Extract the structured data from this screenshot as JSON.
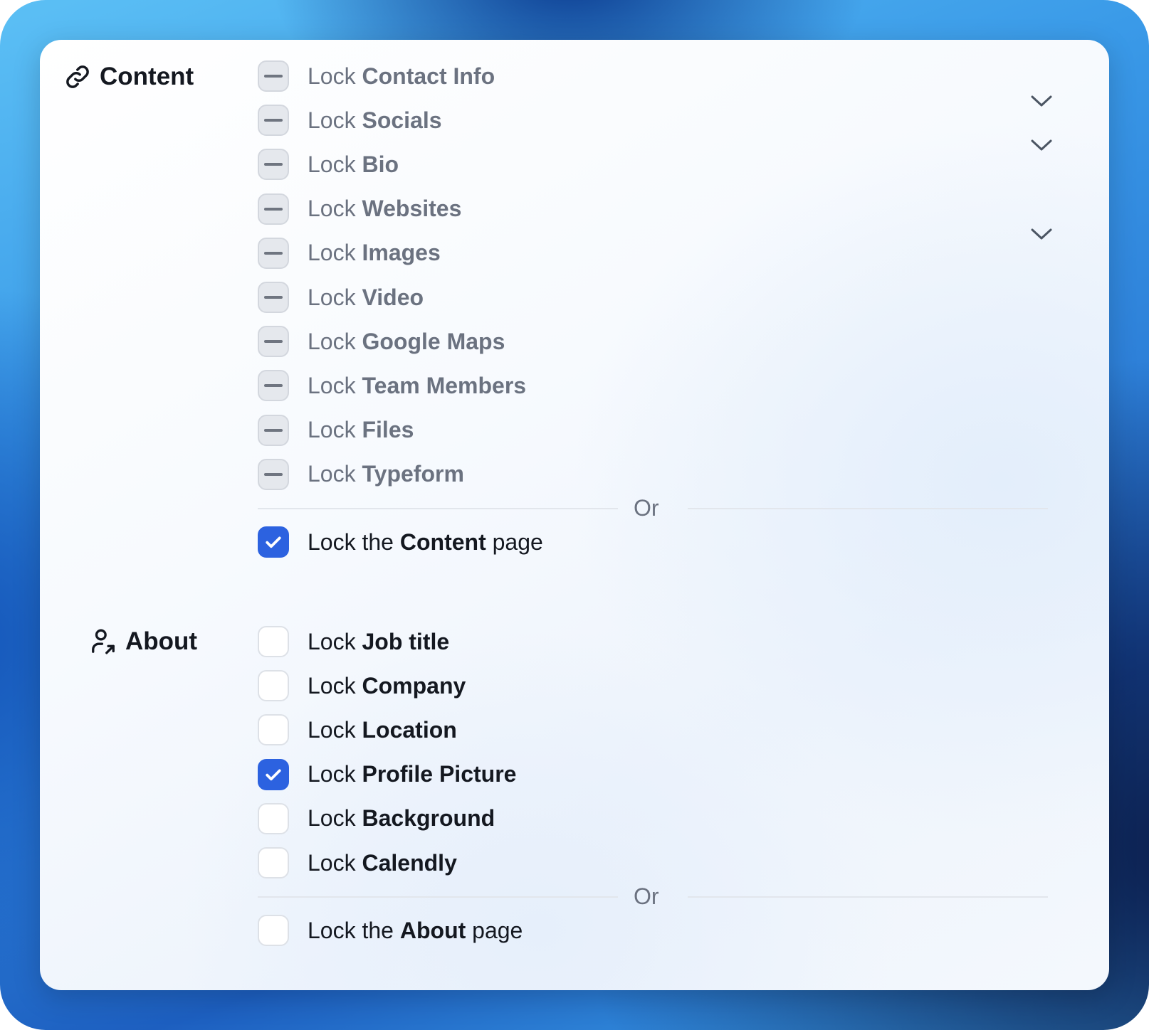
{
  "content_section": {
    "title": "Content",
    "icon": "link-icon",
    "items": [
      {
        "prefix": "Lock",
        "name": "Contact Info",
        "state": "mixed",
        "expandable": true
      },
      {
        "prefix": "Lock",
        "name": "Socials",
        "state": "mixed",
        "expandable": true
      },
      {
        "prefix": "Lock",
        "name": "Bio",
        "state": "mixed",
        "expandable": false
      },
      {
        "prefix": "Lock",
        "name": "Websites",
        "state": "mixed",
        "expandable": true
      },
      {
        "prefix": "Lock",
        "name": "Images",
        "state": "mixed",
        "expandable": false
      },
      {
        "prefix": "Lock",
        "name": "Video",
        "state": "mixed",
        "expandable": false
      },
      {
        "prefix": "Lock",
        "name": "Google Maps",
        "state": "mixed",
        "expandable": false
      },
      {
        "prefix": "Lock",
        "name": "Team Members",
        "state": "mixed",
        "expandable": false
      },
      {
        "prefix": "Lock",
        "name": "Files",
        "state": "mixed",
        "expandable": false
      },
      {
        "prefix": "Lock",
        "name": "Typeform",
        "state": "mixed",
        "expandable": false
      }
    ],
    "or_label": "Or",
    "page_lock": {
      "prefix": "Lock the",
      "name": "Content",
      "suffix": "page",
      "checked": true
    }
  },
  "about_section": {
    "title": "About",
    "icon": "user-share-icon",
    "items": [
      {
        "prefix": "Lock",
        "name": "Job title",
        "checked": false
      },
      {
        "prefix": "Lock",
        "name": "Company",
        "checked": false
      },
      {
        "prefix": "Lock",
        "name": "Location",
        "checked": false
      },
      {
        "prefix": "Lock",
        "name": "Profile Picture",
        "checked": true
      },
      {
        "prefix": "Lock",
        "name": "Background",
        "checked": false
      },
      {
        "prefix": "Lock",
        "name": "Calendly",
        "checked": false
      }
    ],
    "or_label": "Or",
    "page_lock": {
      "prefix": "Lock the",
      "name": "About",
      "suffix": "page",
      "checked": false
    }
  },
  "colors": {
    "accent": "#2c62e0",
    "muted_text": "#6b7280",
    "dark_text": "#141820"
  }
}
